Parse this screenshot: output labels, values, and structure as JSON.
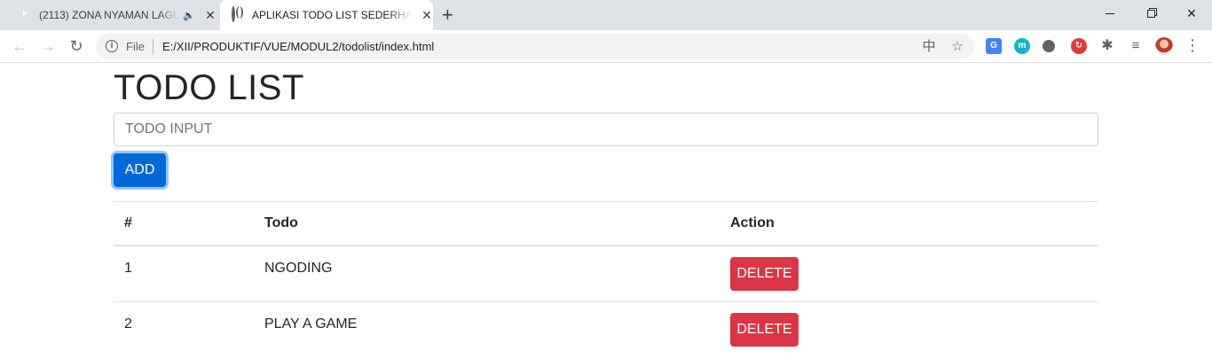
{
  "browser": {
    "tabs": [
      {
        "title": "(2113) ZONA NYAMAN LAGU",
        "favicon": "youtube-icon"
      },
      {
        "title": "APLIKASI TODO LIST SEDERHANA",
        "favicon": "globe-icon"
      }
    ],
    "omnibox": {
      "scheme": "File",
      "url": "E:/XII/PRODUKTIF/VUE/MODUL2/todolist/index.html"
    },
    "extensions": {
      "m_label": "m"
    }
  },
  "app": {
    "heading": "TODO LIST",
    "input_placeholder": "TODO INPUT",
    "add_label": "ADD",
    "table": {
      "headers": [
        "#",
        "Todo",
        "Action"
      ],
      "rows": [
        {
          "num": "1",
          "todo": "NGODING",
          "action": "DELETE"
        },
        {
          "num": "2",
          "todo": "PLAY A GAME",
          "action": "DELETE"
        }
      ]
    }
  },
  "colors": {
    "primary": "#0069d9",
    "danger": "#dc3545",
    "tabstrip": "#dee1e6"
  }
}
